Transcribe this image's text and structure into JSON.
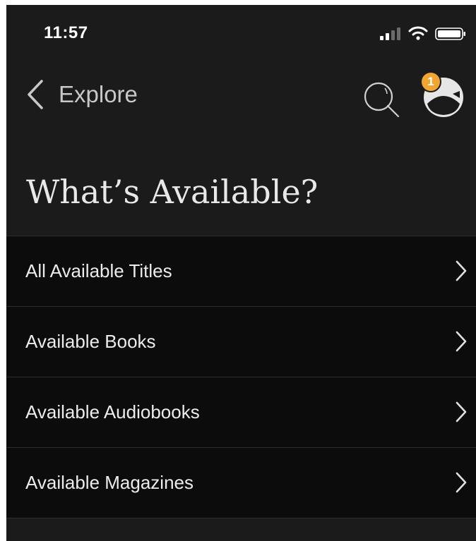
{
  "status_bar": {
    "time": "11:57",
    "icons": [
      "signal-icon",
      "wifi-icon",
      "battery-icon"
    ]
  },
  "nav": {
    "back_label": "Explore",
    "search_icon": "search-icon",
    "avatar_icon": "avatar-icon",
    "notification_count": "1"
  },
  "page": {
    "title": "What’s Available?"
  },
  "menu": {
    "items": [
      {
        "label": "All Available Titles"
      },
      {
        "label": "Available Books"
      },
      {
        "label": "Available Audiobooks"
      },
      {
        "label": "Available Magazines"
      }
    ]
  },
  "colors": {
    "background": "#1b1b1b",
    "list_background": "#0c0c0c",
    "badge": "#f2a531",
    "text": "#ececec"
  }
}
